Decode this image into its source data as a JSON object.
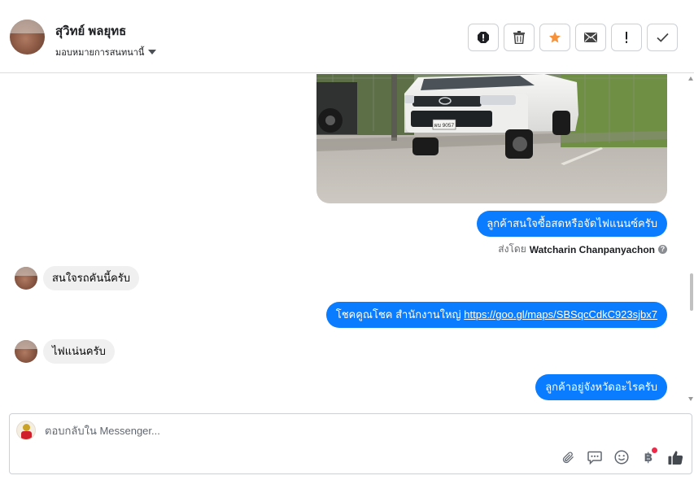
{
  "header": {
    "contact_name": "สุวิทย์ พลยุทธ",
    "assign_label": "มอบหมายการสนทนานี้"
  },
  "toolbar": {
    "buttons": [
      {
        "icon": "alert-circle-icon"
      },
      {
        "icon": "trash-icon"
      },
      {
        "icon": "star-icon",
        "color": "#f7923a"
      },
      {
        "icon": "envelope-icon"
      },
      {
        "icon": "exclamation-icon"
      },
      {
        "icon": "check-icon"
      }
    ]
  },
  "messages": {
    "out_1": "ลูกค้าสนใจซื้อสดหรือจัดไฟแนนซ์ครับ",
    "sent_by_label": "ส่งโดย",
    "sent_by_name": "Watcharin Chanpanyachon",
    "in_1": "สนใจรถคันนี้ครับ",
    "out_2_text": "โชคคูณโชค สำนักงานใหญ่ ",
    "out_2_link": "https://goo.gl/maps/SBSqcCdkC923sjbx7",
    "in_2": "ไฟแน่นครับ",
    "out_3": "ลูกค้าอยู่จังหวัดอะไรครับ",
    "photo_plate": "ผบ 9057"
  },
  "composer": {
    "placeholder": "ตอบกลับใน Messenger..."
  },
  "colors": {
    "accent": "#0a7cff",
    "star": "#f7923a",
    "badge": "#f02849"
  }
}
